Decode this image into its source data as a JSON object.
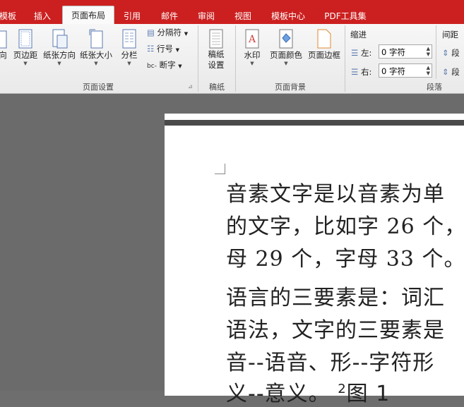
{
  "tabs": [
    "模板",
    "插入",
    "页面布局",
    "引用",
    "邮件",
    "审阅",
    "视图",
    "模板中心",
    "PDF工具集"
  ],
  "ribbon": {
    "page_setup": {
      "buttons": [
        "向",
        "页边距",
        "纸张方向",
        "纸张大小",
        "分栏"
      ],
      "small": [
        "分隔符",
        "行号",
        "断字"
      ],
      "group_label": "页面设置"
    },
    "manuscript": {
      "button": "稿纸\n设置",
      "group_label": "稿纸"
    },
    "background": {
      "buttons": [
        "水印",
        "页面颜色",
        "页面边框"
      ],
      "group_label": "页面背景"
    },
    "paragraph": {
      "indent_title": "缩进",
      "left_label": "左:",
      "left_value": "0 字符",
      "right_label": "右:",
      "right_value": "0 字符",
      "spacing_title": "间距",
      "spacing_item": "段",
      "group_label": "段落"
    }
  },
  "document": {
    "lines": [
      "音素文字是以音素为单",
      "的文字，比如字 26 个，",
      "母 29 个，字母 33 个。",
      " 语言的三要素是：词汇",
      "语法，文字的三要素是",
      "音--语音、形--字符形",
      "义--意义。"
    ],
    "sup": "2",
    "figure": "图 1"
  }
}
